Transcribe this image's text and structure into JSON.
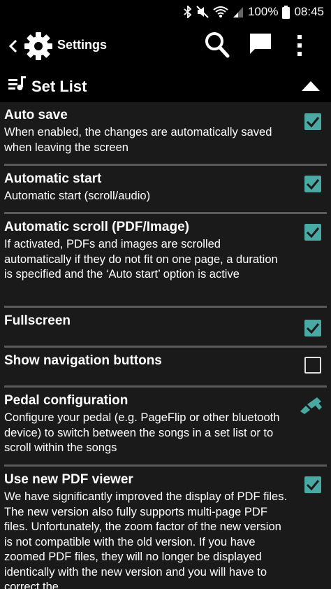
{
  "status_bar": {
    "battery": "100%",
    "time": "08:45"
  },
  "app_bar": {
    "title": "Settings"
  },
  "section": {
    "title": "Set List"
  },
  "settings": [
    {
      "title": "Auto save",
      "description": "When enabled, the changes are automatically saved when leaving the screen",
      "checked": true
    },
    {
      "title": "Automatic start",
      "description": "Automatic start (scroll/audio)",
      "checked": true
    },
    {
      "title": "Automatic scroll (PDF/Image)",
      "description": "If activated, PDFs and images are scrolled automatically if they do not fit on one page, a duration is specified and the ‘Auto start’ option is active",
      "checked": true
    },
    {
      "title": "Fullscreen",
      "description": "",
      "checked": true
    },
    {
      "title": "Show navigation buttons",
      "description": "",
      "checked": false
    },
    {
      "title": "Pedal configuration",
      "description": "Configure your pedal (e.g. PageFlip or other bluetooth device) to switch between the songs in a set list or to scroll within the songs",
      "icon": "brush-icon"
    },
    {
      "title": "Use new PDF viewer",
      "description": "We have significantly improved the display of PDF files. The new version also fully supports multi-page PDF files. Unfortunately, the zoom factor of the new version is not compatible with the old version. If you have zoomed PDF files, they will no longer be displayed identically with the new version and you will have to correct the",
      "checked": true
    }
  ],
  "colors": {
    "accent": "#49a9a3",
    "background": "#1a1a1a",
    "bar": "#000000",
    "divider": "#5a5a5a"
  }
}
